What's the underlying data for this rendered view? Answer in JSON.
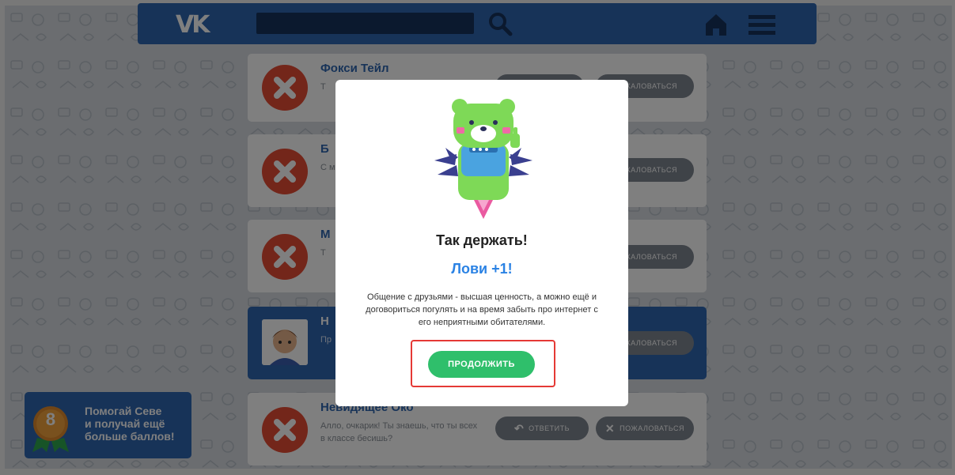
{
  "topbar": {
    "logo_text": "VK",
    "icons": [
      "search-icon",
      "home-icon",
      "menu-icon"
    ]
  },
  "cards": [
    {
      "name": "Фокси Тейл",
      "message": "Т",
      "avatar": "x-icon",
      "buttons": [
        "",
        "ПОЖАЛОВАТЬСЯ"
      ]
    },
    {
      "name": "Б",
      "message": "С м",
      "avatar": "x-icon",
      "buttons": [
        "ПОЖАЛОВАТЬСЯ"
      ]
    },
    {
      "name": "М",
      "message": "Т",
      "avatar": "x-icon",
      "buttons": [
        "ПОЖАЛОВАТЬСЯ"
      ]
    },
    {
      "name": "Н",
      "message": "Пр",
      "avatar": "boy-avatar",
      "buttons": [
        "ПОЖАЛОВАТЬСЯ"
      ],
      "active": true
    },
    {
      "name": "Невидящее Око",
      "message": "Алло, очкарик! Ты знаешь, что ты всех в классе бесишь?",
      "avatar": "x-icon",
      "buttons": [
        "ОТВЕТИТЬ",
        "ПОЖАЛОВАТЬСЯ"
      ]
    }
  ],
  "promo": {
    "level": "8",
    "text": "Помогай Севе\nи получай ещё\nбольше баллов!"
  },
  "modal": {
    "title": "Так держать!",
    "subtitle": "Лови +1!",
    "body": "Общение с друзьями - высшая ценность, а можно ещё и договориться погулять и на время забыть про интернет с его неприятными обитателями.",
    "continue_label": "ПРОДОЛЖИТЬ"
  },
  "colors": {
    "brand_blue": "#2f66b0",
    "accent_green": "#2fbf6b",
    "danger_red": "#e74c35",
    "subtitle_blue": "#2a82e4"
  }
}
